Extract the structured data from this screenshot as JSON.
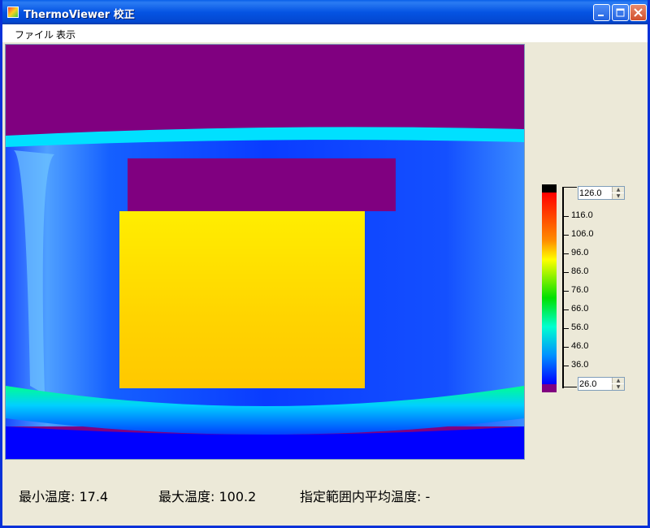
{
  "window": {
    "title": "ThermoViewer 校正"
  },
  "menu": {
    "items": [
      "ファイル",
      "表示"
    ]
  },
  "colorscale": {
    "max_value": "126.0",
    "min_value": "26.0",
    "ticks": [
      "116.0",
      "106.0",
      "96.0",
      "86.0",
      "76.0",
      "66.0",
      "56.0",
      "46.0",
      "36.0"
    ],
    "colors": [
      "#000000",
      "#ff0000",
      "#ff8c00",
      "#ffd700",
      "#ffff00",
      "#a0ff00",
      "#00e000",
      "#00ff90",
      "#00e0ff",
      "#0080ff",
      "#0000ff",
      "#800080"
    ]
  },
  "status": {
    "min_temp": "最小温度: 17.4",
    "max_temp": "最大温度: 100.2",
    "avg_temp": "指定範囲内平均温度: -"
  },
  "thermal_image": {
    "colors": {
      "background": "#800080",
      "container_wall": "#0000ff",
      "container_edge": "#00e0ff",
      "hot_object": "#ffd700",
      "hot_object_core": "#ffee00",
      "floor_edge": "#00ff90"
    }
  }
}
